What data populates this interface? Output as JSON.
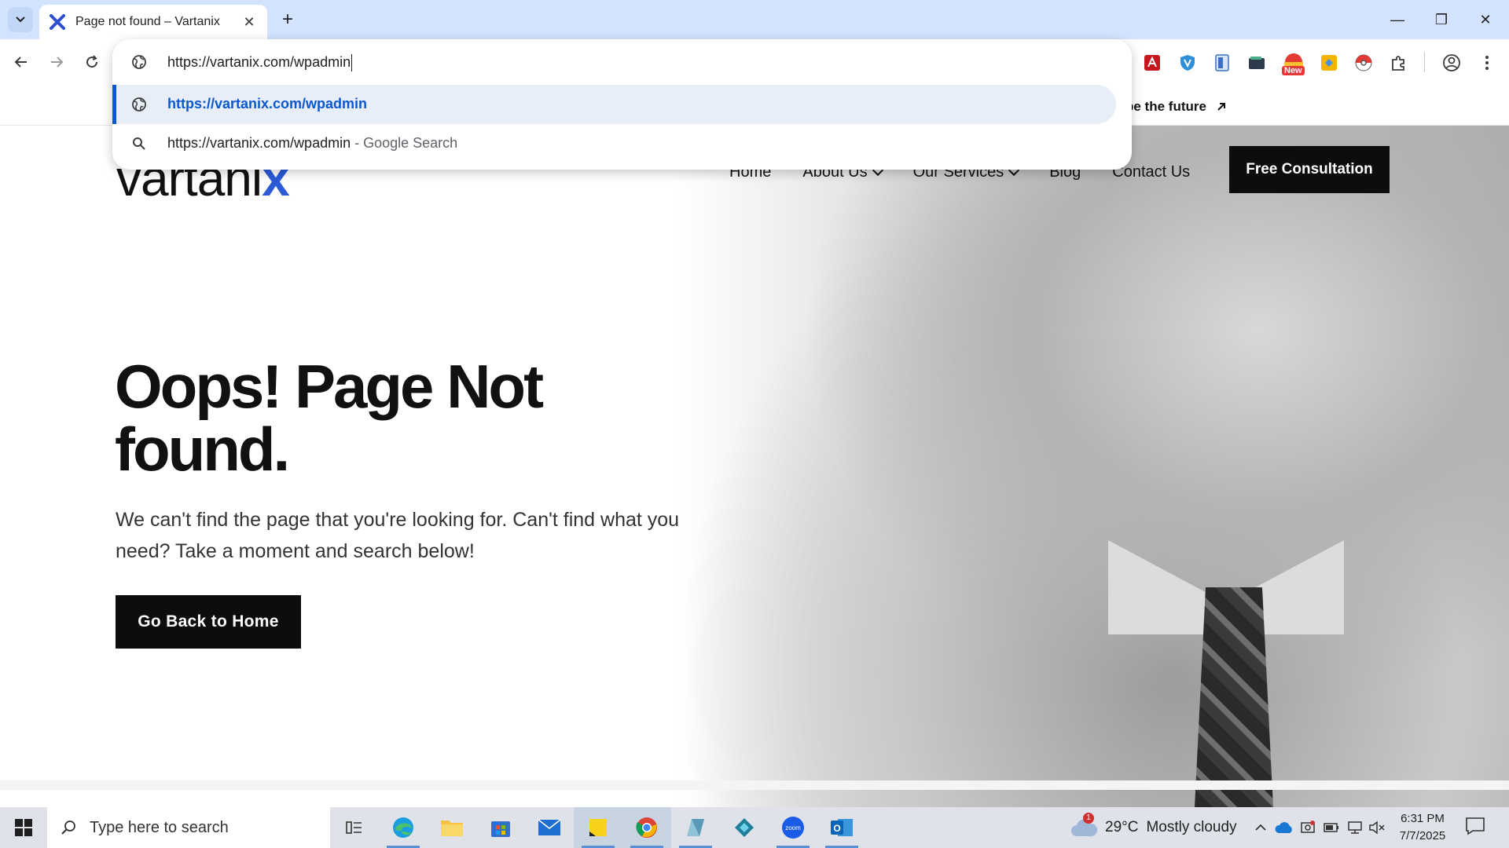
{
  "browser": {
    "tab": {
      "title": "Page not found – Vartanix",
      "favicon": "vartanix-x-icon"
    },
    "omnibox": {
      "value": "https://vartanix.com/wpadmin",
      "suggestions": [
        {
          "text": "https://vartanix.com/wpadmin",
          "suffix": "",
          "icon": "globe-icon"
        },
        {
          "text": "https://vartanix.com/wpadmin",
          "suffix": " - Google Search",
          "icon": "search-icon"
        }
      ]
    },
    "extensions": [
      "acrobat-icon",
      "shield-icon",
      "document-icon",
      "wallet-icon",
      "new-badge-icon",
      "keep-icon",
      "pokeball-icon",
      "puzzle-icon"
    ],
    "new_badge": "New"
  },
  "site": {
    "topbar_text": "be the future",
    "logo": {
      "text": "vartani",
      "x": "x"
    },
    "nav": {
      "home": "Home",
      "about": "About Us",
      "services": "Our Services",
      "blog": "Blog",
      "contact": "Contact Us"
    },
    "consult_button": "Free Consultation",
    "hero": {
      "title": "Oops! Page Not found.",
      "description": "We can't find the page that you're looking for. Can't find what you need? Take a moment and search below!",
      "button": "Go Back to Home"
    }
  },
  "taskbar": {
    "search_placeholder": "Type here to search",
    "weather": {
      "temp": "29°C",
      "condition": "Mostly cloudy",
      "badge": "1"
    },
    "clock": {
      "time": "6:31 PM",
      "date": "7/7/2025"
    }
  }
}
